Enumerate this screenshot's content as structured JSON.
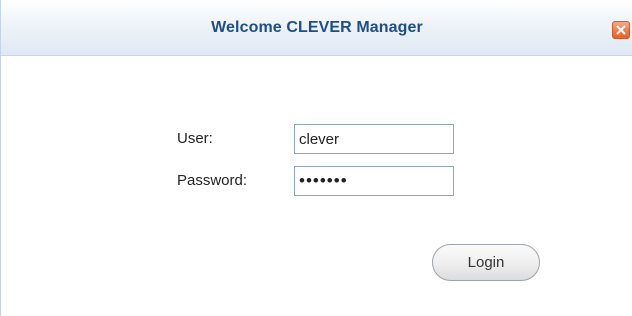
{
  "dialog": {
    "title": "Welcome CLEVER Manager",
    "close_icon": "close-x-icon"
  },
  "form": {
    "user_label": "User:",
    "user_value": "clever",
    "password_label": "Password:",
    "password_value": "clever1"
  },
  "actions": {
    "login_label": "Login"
  },
  "colors": {
    "title_text": "#1d4f86",
    "titlebar_gradient_end": "#dfe8f3",
    "close_button": "#ee7648",
    "field_border": "#8fa6c2"
  }
}
